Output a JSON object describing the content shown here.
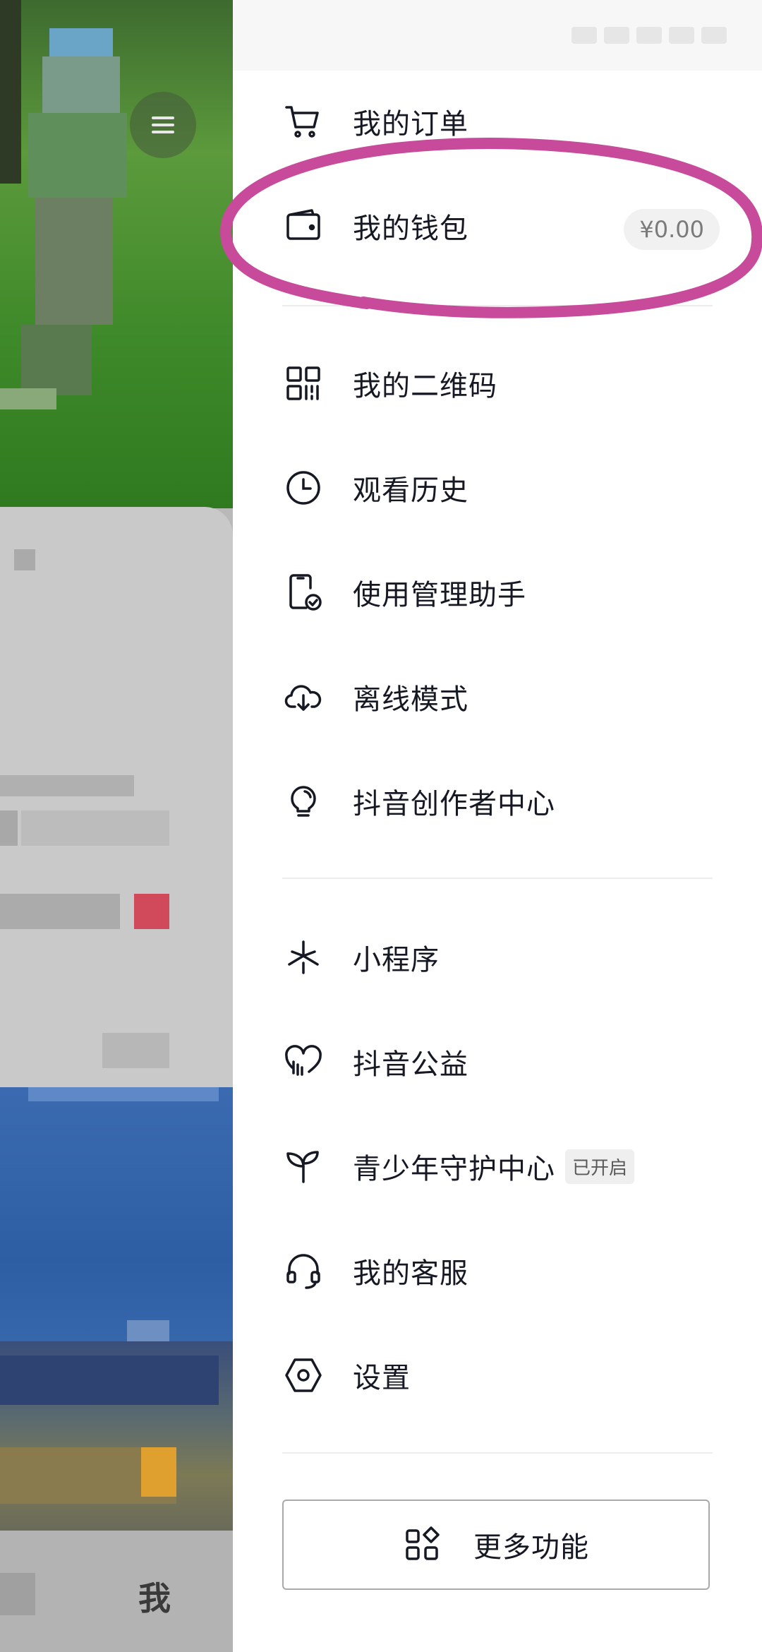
{
  "background": {
    "tab_me_label": "我"
  },
  "drawer": {
    "menu_group_1": [
      {
        "label": "我的订单",
        "icon": "cart-icon"
      },
      {
        "label": "我的钱包",
        "icon": "wallet-icon",
        "value": "¥0.00"
      }
    ],
    "menu_group_2": [
      {
        "label": "我的二维码",
        "icon": "qr-code-icon"
      },
      {
        "label": "观看历史",
        "icon": "clock-icon"
      },
      {
        "label": "使用管理助手",
        "icon": "phone-check-icon"
      },
      {
        "label": "离线模式",
        "icon": "cloud-download-icon"
      },
      {
        "label": "抖音创作者中心",
        "icon": "lightbulb-icon"
      }
    ],
    "menu_group_3": [
      {
        "label": "小程序",
        "icon": "mini-program-icon"
      },
      {
        "label": "抖音公益",
        "icon": "heart-charity-icon"
      },
      {
        "label": "青少年守护中心",
        "icon": "sprout-icon",
        "badge": "已开启"
      },
      {
        "label": "我的客服",
        "icon": "headset-icon"
      },
      {
        "label": "设置",
        "icon": "settings-hexagon-icon"
      }
    ],
    "more_button_label": "更多功能",
    "more_button_icon": "apps-grid-icon"
  },
  "colors": {
    "text": "#161823",
    "annotation": "#c84a9a"
  }
}
